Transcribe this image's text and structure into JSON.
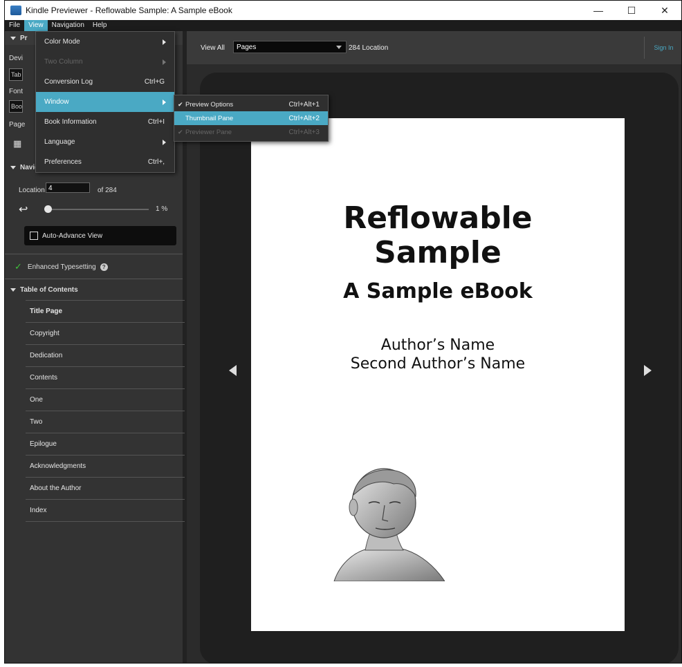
{
  "window": {
    "title": "Kindle Previewer - Reflowable Sample: A Sample eBook",
    "controls": [
      "—",
      "☐",
      "✕"
    ]
  },
  "menubar": [
    "File",
    "View",
    "Navigation",
    "Help"
  ],
  "view_menu": [
    {
      "label": "Color Mode",
      "shortcut": "",
      "submenu": true,
      "disabled": false
    },
    {
      "label": "Two Column",
      "shortcut": "",
      "submenu": true,
      "disabled": true
    },
    {
      "label": "Conversion Log",
      "shortcut": "Ctrl+G",
      "submenu": false,
      "disabled": false
    },
    {
      "label": "Window",
      "shortcut": "",
      "submenu": true,
      "disabled": false,
      "selected": true
    },
    {
      "label": "Book Information",
      "shortcut": "Ctrl+I",
      "submenu": false,
      "disabled": false
    },
    {
      "label": "Language",
      "shortcut": "",
      "submenu": true,
      "disabled": false
    },
    {
      "label": "Preferences",
      "shortcut": "Ctrl+,",
      "submenu": false,
      "disabled": false
    }
  ],
  "window_submenu": [
    {
      "label": "Preview Options",
      "shortcut": "Ctrl+Alt+1",
      "checked": true,
      "selected": false,
      "disabled": false
    },
    {
      "label": "Thumbnail Pane",
      "shortcut": "Ctrl+Alt+2",
      "checked": false,
      "selected": true,
      "disabled": false
    },
    {
      "label": "Previewer Pane",
      "shortcut": "Ctrl+Alt+3",
      "checked": true,
      "selected": false,
      "disabled": true
    }
  ],
  "left_panel": {
    "preview_section_stub": "Pr",
    "device_stub": "Devi",
    "device_value_stub": "Tab",
    "font_stub": "Font",
    "font_value_stub": "Boo",
    "page_stub": "Page",
    "navigation_header": "Navigation",
    "location_label": "Location",
    "location_value": "4",
    "location_total": "of 284",
    "progress_text": "1 %",
    "progress_fraction": 0.01,
    "auto_advance": "Auto-Advance View",
    "enhanced_typesetting": "Enhanced Typesetting",
    "toc_header": "Table of Contents",
    "toc_items": [
      "Title Page",
      "Copyright",
      "Dedication",
      "Contents",
      "One",
      "Two",
      "Epilogue",
      "Acknowledgments",
      "About the Author",
      "Index"
    ]
  },
  "topbar": {
    "view_all_label": "View All",
    "view_select": "Pages",
    "location_count": "284 Location",
    "sign_in": "Sign In"
  },
  "book_page": {
    "title_line1": "Reflowable",
    "title_line2": "Sample",
    "subtitle": "A Sample eBook",
    "author1": "Author’s Name",
    "author2": "Second Author’s Name"
  },
  "colors": {
    "accent": "#4aa9c4",
    "panel": "#333333",
    "check_green": "#3fc43a"
  }
}
